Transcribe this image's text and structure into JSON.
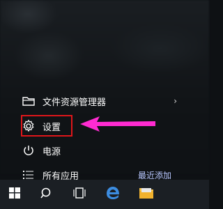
{
  "start_menu": {
    "items": [
      {
        "label": "文件资源管理器",
        "icon": "folder-icon",
        "has_arrow": true
      },
      {
        "label": "设置",
        "icon": "gear-icon",
        "highlighted": true
      },
      {
        "label": "电源",
        "icon": "power-icon"
      },
      {
        "label": "所有应用",
        "icon": "list-icon",
        "right_link": "最近添加"
      }
    ],
    "chevron": "›"
  },
  "annotation": {
    "highlight_color": "#e0161a",
    "arrow_color": "#ff2bd1"
  },
  "taskbar": {
    "icons": [
      "windows-start-icon",
      "search-icon",
      "task-view-icon",
      "edge-icon",
      "file-explorer-icon"
    ]
  }
}
